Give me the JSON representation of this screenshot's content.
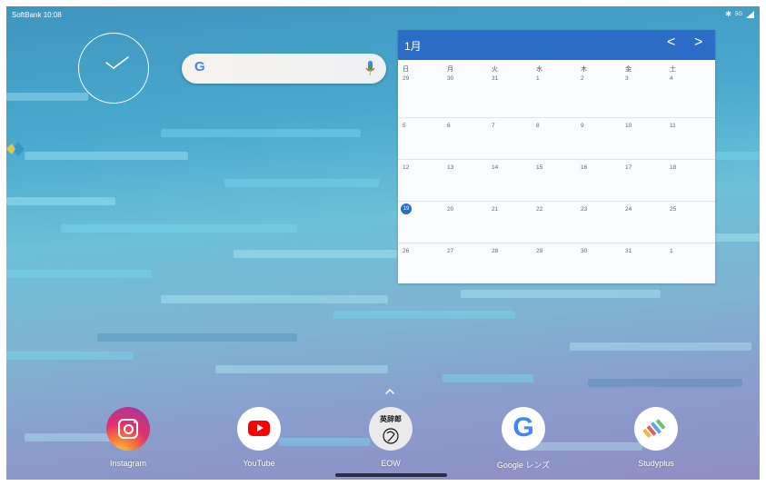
{
  "status_bar": {
    "carrier_time": "SoftBank 10:08",
    "network": "5G"
  },
  "search_widget": {
    "logo_letter": "G"
  },
  "calendar": {
    "month": "1月",
    "prev": "<",
    "next": ">",
    "weekdays": [
      "日",
      "月",
      "火",
      "水",
      "木",
      "金",
      "土"
    ],
    "weeks": [
      [
        "29",
        "30",
        "31",
        "1",
        "2",
        "3",
        "4"
      ],
      [
        "5",
        "6",
        "7",
        "8",
        "9",
        "10",
        "11"
      ],
      [
        "12",
        "13",
        "14",
        "15",
        "16",
        "17",
        "18"
      ],
      [
        "19",
        "20",
        "21",
        "22",
        "23",
        "24",
        "25"
      ],
      [
        "26",
        "27",
        "28",
        "29",
        "30",
        "31",
        "1"
      ]
    ],
    "today": "19",
    "accent": "#2b6cc7"
  },
  "dock": [
    {
      "label": "Instagram",
      "icon": "instagram-icon"
    },
    {
      "label": "YouTube",
      "icon": "youtube-icon"
    },
    {
      "label": "EOW",
      "icon": "eow-icon",
      "badge": "英辞郎"
    },
    {
      "label": "Google レンズ",
      "icon": "google-lens-icon",
      "letter": "G"
    },
    {
      "label": "Studyplus",
      "icon": "studyplus-icon"
    }
  ]
}
